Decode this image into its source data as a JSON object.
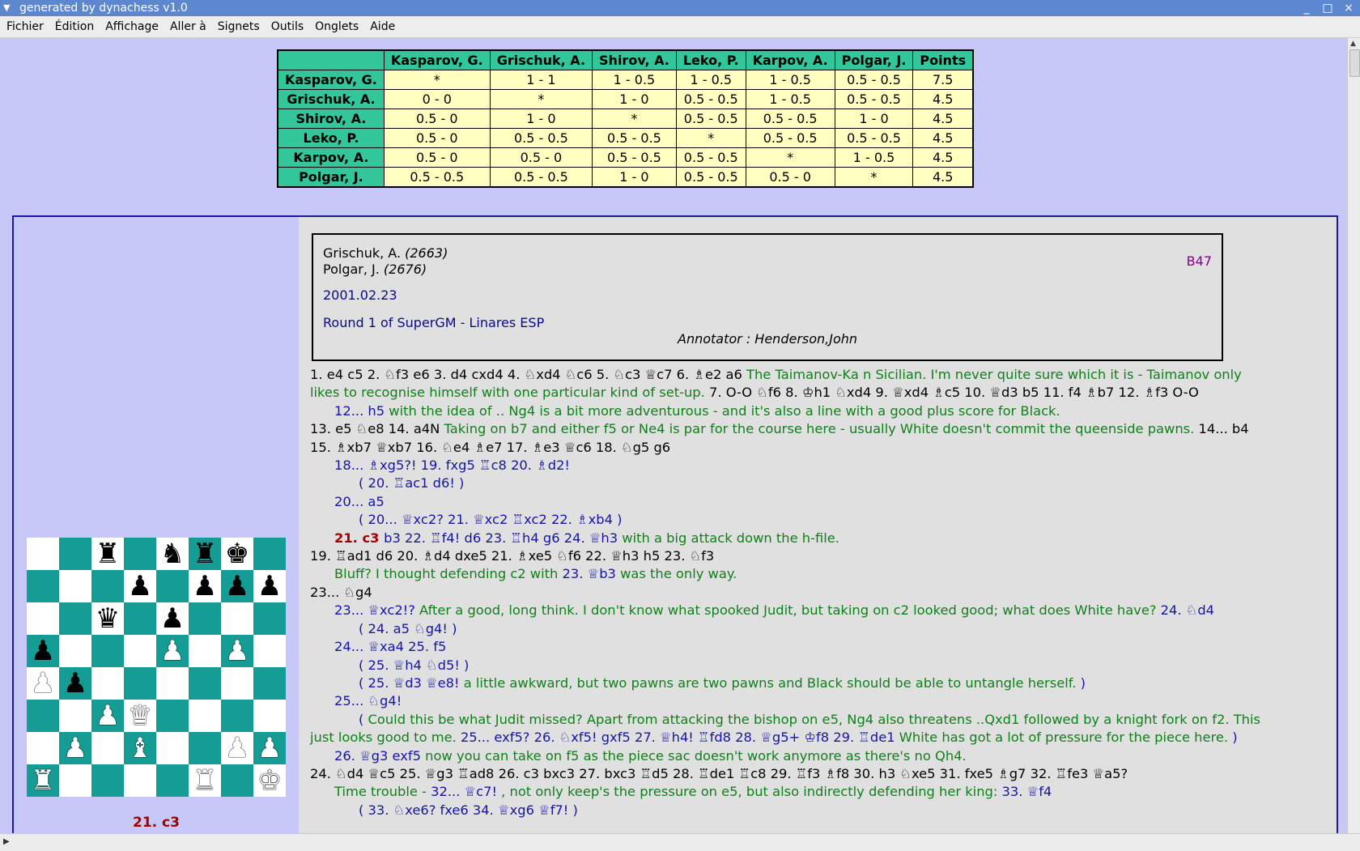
{
  "window": {
    "title": "generated by dynachess v1.0",
    "buttons": [
      "_",
      "□",
      "×"
    ]
  },
  "menu": [
    "Fichier",
    "Édition",
    "Affichage",
    "Aller à",
    "Signets",
    "Outils",
    "Onglets",
    "Aide"
  ],
  "crosstable": {
    "headers": [
      "",
      "Kasparov, G.",
      "Grischuk, A.",
      "Shirov, A.",
      "Leko, P.",
      "Karpov, A.",
      "Polgar, J.",
      "Points"
    ],
    "rows": [
      [
        "Kasparov, G.",
        "*",
        "1 - 1",
        "1 - 0.5",
        "1 - 0.5",
        "1 - 0.5",
        "0.5 - 0.5",
        "7.5"
      ],
      [
        "Grischuk, A.",
        "0 - 0",
        "*",
        "1 - 0",
        "0.5 - 0.5",
        "1 - 0.5",
        "0.5 - 0.5",
        "4.5"
      ],
      [
        "Shirov, A.",
        "0.5 - 0",
        "1 - 0",
        "*",
        "0.5 - 0.5",
        "0.5 - 0.5",
        "1 - 0",
        "4.5"
      ],
      [
        "Leko, P.",
        "0.5 - 0",
        "0.5 - 0.5",
        "0.5 - 0.5",
        "*",
        "0.5 - 0.5",
        "0.5 - 0.5",
        "4.5"
      ],
      [
        "Karpov, A.",
        "0.5 - 0",
        "0.5 - 0",
        "0.5 - 0.5",
        "0.5 - 0.5",
        "*",
        "1 - 0.5",
        "4.5"
      ],
      [
        "Polgar, J.",
        "0.5 - 0.5",
        "0.5 - 0.5",
        "1 - 0",
        "0.5 - 0.5",
        "0.5 - 0",
        "*",
        "4.5"
      ]
    ]
  },
  "game": {
    "white": "Grischuk, A.",
    "white_elo": "(2663)",
    "black": "Polgar, J.",
    "black_elo": "(2676)",
    "date": "2001.02.23",
    "round": "Round 1 of SuperGM - Linares ESP",
    "annotator": "Annotator : Henderson,John",
    "eco": "B47",
    "current_move": "21. c3"
  },
  "board": [
    [
      ".",
      ".",
      "bR",
      ".",
      "bN",
      "bR",
      "bK",
      "."
    ],
    [
      ".",
      ".",
      ".",
      "bP",
      ".",
      "bP",
      "bP",
      "bP"
    ],
    [
      ".",
      ".",
      "bQ",
      ".",
      "bP",
      ".",
      ".",
      "."
    ],
    [
      "bP",
      ".",
      ".",
      ".",
      "wP",
      ".",
      "wP",
      "."
    ],
    [
      "wP",
      "bP",
      ".",
      ".",
      ".",
      ".",
      ".",
      "."
    ],
    [
      ".",
      ".",
      "wP",
      "wQ",
      ".",
      ".",
      ".",
      "."
    ],
    [
      ".",
      "wP",
      ".",
      "wB",
      ".",
      ".",
      "wP",
      "wP"
    ],
    [
      "wR",
      ".",
      ".",
      ".",
      ".",
      "wR",
      ".",
      "wK"
    ]
  ],
  "colors": {
    "light_square": "#ffffff",
    "dark_square": "#159c94",
    "table_header": "#33c69a",
    "table_cell": "#ffffc0",
    "comment": "#10801a",
    "variation": "#1515a0",
    "current": "#a00000"
  },
  "moves": [
    {
      "indent": 0,
      "parts": [
        [
          "m",
          "1. e4 c5 2. ♘f3 e6 3. d4 cxd4 4. ♘xd4 ♘c6 5. ♘c3 ♕c7 6. ♗e2 a6 "
        ],
        [
          "c",
          "The Taimanov-Ka n Sicilian. I'm never quite sure which it is - Taimanov only"
        ]
      ]
    },
    {
      "indent": 0,
      "parts": [
        [
          "c",
          "likes to recognise himself with one particular kind of set-up. "
        ],
        [
          "m",
          "7. O-O ♘f6 8. ♔h1 ♘xd4 9. ♕xd4 ♗c5 10. ♕d3 b5 11. f4 ♗b7 12. ♗f3 O-O"
        ]
      ]
    },
    {
      "indent": 1,
      "parts": [
        [
          "v",
          "12... h5 "
        ],
        [
          "c",
          "with the idea of .. Ng4 is a bit more adventurous - and it's also a line with a good plus score for Black."
        ]
      ]
    },
    {
      "indent": 0,
      "parts": [
        [
          "m",
          "13. e5 ♘e8 14. a4N "
        ],
        [
          "c",
          "Taking on b7 and either f5 or Ne4 is par for the course here - usually White doesn't commit the queenside pawns. "
        ],
        [
          "m",
          "14... b4"
        ]
      ]
    },
    {
      "indent": 0,
      "parts": [
        [
          "m",
          "15. ♗xb7 ♕xb7 16. ♘e4 ♗e7 17. ♗e3 ♕c6 18. ♘g5 g6"
        ]
      ]
    },
    {
      "indent": 1,
      "parts": [
        [
          "v",
          "18... ♗xg5?! 19. fxg5 ♖c8 20. ♗d2!"
        ]
      ]
    },
    {
      "indent": 2,
      "parts": [
        [
          "v",
          "( 20. ♖ac1 d6! )"
        ]
      ]
    },
    {
      "indent": 1,
      "parts": [
        [
          "v",
          "20... a5"
        ]
      ]
    },
    {
      "indent": 2,
      "parts": [
        [
          "v",
          "( 20... ♕xc2? 21. ♕xc2 ♖xc2 22. ♗xb4 )"
        ]
      ]
    },
    {
      "indent": 1,
      "parts": [
        [
          "cur",
          "21. c3 "
        ],
        [
          "v",
          "b3 22. ♖f4! d6 23. ♖h4 g6 24. ♕h3 "
        ],
        [
          "c",
          "with a big attack down the h-file."
        ]
      ]
    },
    {
      "indent": 0,
      "parts": [
        [
          "m",
          "19. ♖ad1 d6 20. ♗d4 dxe5 21. ♗xe5 ♘f6 22. ♕h3 h5 23. ♘f3"
        ]
      ]
    },
    {
      "indent": 1,
      "parts": [
        [
          "c",
          "Bluff? I thought defending c2 with "
        ],
        [
          "v",
          "23. ♕b3 "
        ],
        [
          "c",
          "was the only way."
        ]
      ]
    },
    {
      "indent": 0,
      "parts": [
        [
          "m",
          "23... ♘g4"
        ]
      ]
    },
    {
      "indent": 1,
      "parts": [
        [
          "v",
          "23... ♕xc2!? "
        ],
        [
          "c",
          "After a good, long think. I don't know what spooked Judit, but taking on c2 looked good; what does White have? "
        ],
        [
          "v",
          "24. ♘d4"
        ]
      ]
    },
    {
      "indent": 2,
      "parts": [
        [
          "v",
          "( 24. a5 ♘g4! )"
        ]
      ]
    },
    {
      "indent": 1,
      "parts": [
        [
          "v",
          "24... ♕xa4 25. f5"
        ]
      ]
    },
    {
      "indent": 2,
      "parts": [
        [
          "v",
          "( 25. ♕h4 ♘d5! )"
        ]
      ]
    },
    {
      "indent": 2,
      "parts": [
        [
          "v",
          "( 25. ♕d3 ♕e8! "
        ],
        [
          "c",
          "a little awkward, but two pawns are two pawns and Black should be able to untangle herself. "
        ],
        [
          "v",
          ")"
        ]
      ]
    },
    {
      "indent": 1,
      "parts": [
        [
          "v",
          "25... ♘g4!"
        ]
      ]
    },
    {
      "indent": 2,
      "parts": [
        [
          "v",
          "( "
        ],
        [
          "c",
          "Could this be what Judit missed? Apart from attacking the bishop on e5, Ng4 also threatens ..Qxd1 followed by a knight fork on f2. This"
        ]
      ]
    },
    {
      "indent": 0,
      "parts": [
        [
          "c",
          "just looks good to me. "
        ],
        [
          "v",
          "25... exf5? 26. ♘xf5! gxf5 27. ♕h4! ♖fd8 28. ♕g5+ ♔f8 29. ♖de1 "
        ],
        [
          "c",
          "White has got a lot of pressure for the piece here. "
        ],
        [
          "v",
          ")"
        ]
      ]
    },
    {
      "indent": 1,
      "parts": [
        [
          "v",
          "26. ♕g3 exf5 "
        ],
        [
          "c",
          "now you can take on f5 as the piece sac doesn't work anymore as there's no Qh4."
        ]
      ]
    },
    {
      "indent": 0,
      "parts": [
        [
          "m",
          "24. ♘d4 ♕c5 25. ♕g3 ♖ad8 26. c3 bxc3 27. bxc3 ♖d5 28. ♖de1 ♖c8 29. ♖f3 ♗f8 30. h3 ♘xe5 31. fxe5 ♗g7 32. ♖fe3 ♕a5?"
        ]
      ]
    },
    {
      "indent": 1,
      "parts": [
        [
          "c",
          "Time trouble - "
        ],
        [
          "v",
          "32... ♕c7! "
        ],
        [
          "c",
          ", not only keep's the pressure on e5, but also indirectly defending her king: "
        ],
        [
          "v",
          "33. ♕f4"
        ]
      ]
    },
    {
      "indent": 2,
      "parts": [
        [
          "v",
          "( 33. ♘xe6? fxe6 34. ♕xg6 ♕f7! )"
        ]
      ]
    }
  ]
}
